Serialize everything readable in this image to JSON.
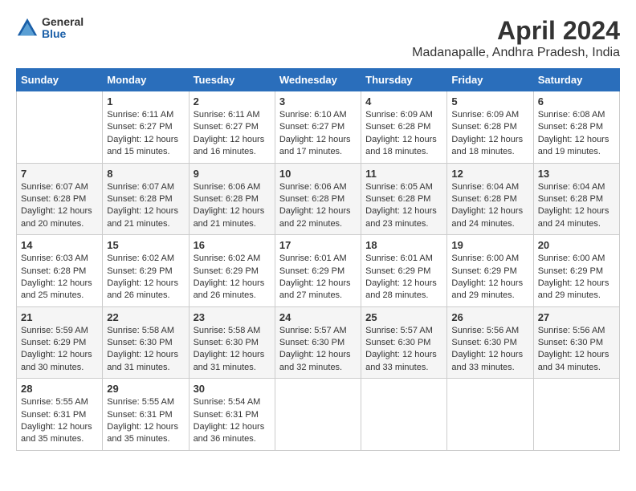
{
  "title": "April 2024",
  "subtitle": "Madanapalle, Andhra Pradesh, India",
  "logo": {
    "general": "General",
    "blue": "Blue"
  },
  "columns": [
    "Sunday",
    "Monday",
    "Tuesday",
    "Wednesday",
    "Thursday",
    "Friday",
    "Saturday"
  ],
  "weeks": [
    [
      {
        "day": "",
        "sunrise": "",
        "sunset": "",
        "daylight": ""
      },
      {
        "day": "1",
        "sunrise": "Sunrise: 6:11 AM",
        "sunset": "Sunset: 6:27 PM",
        "daylight": "Daylight: 12 hours and 15 minutes."
      },
      {
        "day": "2",
        "sunrise": "Sunrise: 6:11 AM",
        "sunset": "Sunset: 6:27 PM",
        "daylight": "Daylight: 12 hours and 16 minutes."
      },
      {
        "day": "3",
        "sunrise": "Sunrise: 6:10 AM",
        "sunset": "Sunset: 6:27 PM",
        "daylight": "Daylight: 12 hours and 17 minutes."
      },
      {
        "day": "4",
        "sunrise": "Sunrise: 6:09 AM",
        "sunset": "Sunset: 6:28 PM",
        "daylight": "Daylight: 12 hours and 18 minutes."
      },
      {
        "day": "5",
        "sunrise": "Sunrise: 6:09 AM",
        "sunset": "Sunset: 6:28 PM",
        "daylight": "Daylight: 12 hours and 18 minutes."
      },
      {
        "day": "6",
        "sunrise": "Sunrise: 6:08 AM",
        "sunset": "Sunset: 6:28 PM",
        "daylight": "Daylight: 12 hours and 19 minutes."
      }
    ],
    [
      {
        "day": "7",
        "sunrise": "Sunrise: 6:07 AM",
        "sunset": "Sunset: 6:28 PM",
        "daylight": "Daylight: 12 hours and 20 minutes."
      },
      {
        "day": "8",
        "sunrise": "Sunrise: 6:07 AM",
        "sunset": "Sunset: 6:28 PM",
        "daylight": "Daylight: 12 hours and 21 minutes."
      },
      {
        "day": "9",
        "sunrise": "Sunrise: 6:06 AM",
        "sunset": "Sunset: 6:28 PM",
        "daylight": "Daylight: 12 hours and 21 minutes."
      },
      {
        "day": "10",
        "sunrise": "Sunrise: 6:06 AM",
        "sunset": "Sunset: 6:28 PM",
        "daylight": "Daylight: 12 hours and 22 minutes."
      },
      {
        "day": "11",
        "sunrise": "Sunrise: 6:05 AM",
        "sunset": "Sunset: 6:28 PM",
        "daylight": "Daylight: 12 hours and 23 minutes."
      },
      {
        "day": "12",
        "sunrise": "Sunrise: 6:04 AM",
        "sunset": "Sunset: 6:28 PM",
        "daylight": "Daylight: 12 hours and 24 minutes."
      },
      {
        "day": "13",
        "sunrise": "Sunrise: 6:04 AM",
        "sunset": "Sunset: 6:28 PM",
        "daylight": "Daylight: 12 hours and 24 minutes."
      }
    ],
    [
      {
        "day": "14",
        "sunrise": "Sunrise: 6:03 AM",
        "sunset": "Sunset: 6:28 PM",
        "daylight": "Daylight: 12 hours and 25 minutes."
      },
      {
        "day": "15",
        "sunrise": "Sunrise: 6:02 AM",
        "sunset": "Sunset: 6:29 PM",
        "daylight": "Daylight: 12 hours and 26 minutes."
      },
      {
        "day": "16",
        "sunrise": "Sunrise: 6:02 AM",
        "sunset": "Sunset: 6:29 PM",
        "daylight": "Daylight: 12 hours and 26 minutes."
      },
      {
        "day": "17",
        "sunrise": "Sunrise: 6:01 AM",
        "sunset": "Sunset: 6:29 PM",
        "daylight": "Daylight: 12 hours and 27 minutes."
      },
      {
        "day": "18",
        "sunrise": "Sunrise: 6:01 AM",
        "sunset": "Sunset: 6:29 PM",
        "daylight": "Daylight: 12 hours and 28 minutes."
      },
      {
        "day": "19",
        "sunrise": "Sunrise: 6:00 AM",
        "sunset": "Sunset: 6:29 PM",
        "daylight": "Daylight: 12 hours and 29 minutes."
      },
      {
        "day": "20",
        "sunrise": "Sunrise: 6:00 AM",
        "sunset": "Sunset: 6:29 PM",
        "daylight": "Daylight: 12 hours and 29 minutes."
      }
    ],
    [
      {
        "day": "21",
        "sunrise": "Sunrise: 5:59 AM",
        "sunset": "Sunset: 6:29 PM",
        "daylight": "Daylight: 12 hours and 30 minutes."
      },
      {
        "day": "22",
        "sunrise": "Sunrise: 5:58 AM",
        "sunset": "Sunset: 6:30 PM",
        "daylight": "Daylight: 12 hours and 31 minutes."
      },
      {
        "day": "23",
        "sunrise": "Sunrise: 5:58 AM",
        "sunset": "Sunset: 6:30 PM",
        "daylight": "Daylight: 12 hours and 31 minutes."
      },
      {
        "day": "24",
        "sunrise": "Sunrise: 5:57 AM",
        "sunset": "Sunset: 6:30 PM",
        "daylight": "Daylight: 12 hours and 32 minutes."
      },
      {
        "day": "25",
        "sunrise": "Sunrise: 5:57 AM",
        "sunset": "Sunset: 6:30 PM",
        "daylight": "Daylight: 12 hours and 33 minutes."
      },
      {
        "day": "26",
        "sunrise": "Sunrise: 5:56 AM",
        "sunset": "Sunset: 6:30 PM",
        "daylight": "Daylight: 12 hours and 33 minutes."
      },
      {
        "day": "27",
        "sunrise": "Sunrise: 5:56 AM",
        "sunset": "Sunset: 6:30 PM",
        "daylight": "Daylight: 12 hours and 34 minutes."
      }
    ],
    [
      {
        "day": "28",
        "sunrise": "Sunrise: 5:55 AM",
        "sunset": "Sunset: 6:31 PM",
        "daylight": "Daylight: 12 hours and 35 minutes."
      },
      {
        "day": "29",
        "sunrise": "Sunrise: 5:55 AM",
        "sunset": "Sunset: 6:31 PM",
        "daylight": "Daylight: 12 hours and 35 minutes."
      },
      {
        "day": "30",
        "sunrise": "Sunrise: 5:54 AM",
        "sunset": "Sunset: 6:31 PM",
        "daylight": "Daylight: 12 hours and 36 minutes."
      },
      {
        "day": "",
        "sunrise": "",
        "sunset": "",
        "daylight": ""
      },
      {
        "day": "",
        "sunrise": "",
        "sunset": "",
        "daylight": ""
      },
      {
        "day": "",
        "sunrise": "",
        "sunset": "",
        "daylight": ""
      },
      {
        "day": "",
        "sunrise": "",
        "sunset": "",
        "daylight": ""
      }
    ]
  ]
}
